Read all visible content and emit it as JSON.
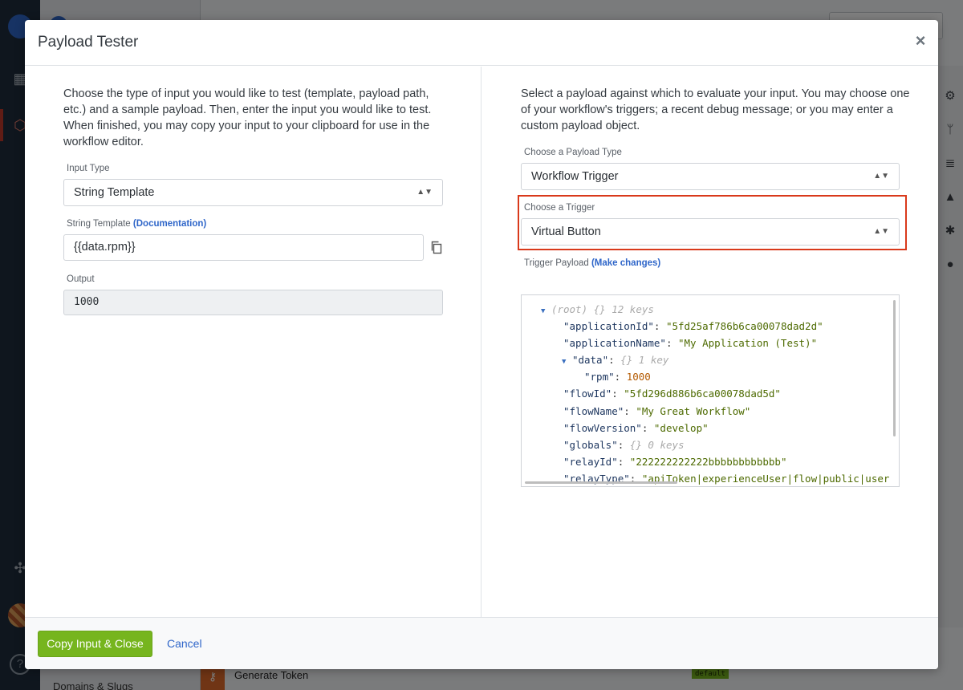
{
  "background": {
    "generate_token_label": "Generate Token",
    "default_badge": "default",
    "domains_label": "Domains & Slugs"
  },
  "modal": {
    "title": "Payload Tester",
    "close_symbol": "×",
    "left": {
      "intro": "Choose the type of input you would like to test (template, payload path, etc.) and a sample payload. Then, enter the input you would like to test. When finished, you may copy your input to your clipboard for use in the workflow editor.",
      "input_type_label": "Input Type",
      "input_type_value": "String Template",
      "string_template_label": "String Template",
      "documentation_link": "(Documentation)",
      "string_template_value": "{{data.rpm}}",
      "output_label": "Output",
      "output_value": "1000"
    },
    "right": {
      "intro": "Select a payload against which to evaluate your input. You may choose one of your workflow's triggers; a recent debug message; or you may enter a custom payload object.",
      "payload_type_label": "Choose a Payload Type",
      "payload_type_value": "Workflow Trigger",
      "trigger_label": "Choose a Trigger",
      "trigger_value": "Virtual Button",
      "trigger_payload_label": "Trigger Payload",
      "make_changes_link": "(Make changes)"
    },
    "footer": {
      "copy_button": "Copy Input & Close",
      "cancel_button": "Cancel"
    }
  },
  "payload_json": {
    "root_label": "(root)",
    "root_braces": "{}",
    "root_count": "12 keys",
    "applicationId_key": "\"applicationId\"",
    "applicationId_val": "\"5fd25af786b6ca00078dad2d\"",
    "applicationName_key": "\"applicationName\"",
    "applicationName_val": "\"My Application (Test)\"",
    "data_key": "\"data\"",
    "data_braces": "{}",
    "data_count": "1 key",
    "rpm_key": "\"rpm\"",
    "rpm_val": "1000",
    "flowId_key": "\"flowId\"",
    "flowId_val": "\"5fd296d886b6ca00078dad5d\"",
    "flowName_key": "\"flowName\"",
    "flowName_val": "\"My Great Workflow\"",
    "flowVersion_key": "\"flowVersion\"",
    "flowVersion_val": "\"develop\"",
    "globals_key": "\"globals\"",
    "globals_braces": "{}",
    "globals_count": "0 keys",
    "relayId_key": "\"relayId\"",
    "relayId_val": "\"222222222222bbbbbbbbbbbb\"",
    "relayType_key": "\"relayType\"",
    "relayType_val": "\"apiToken|experienceUser|flow|public|user"
  },
  "colors": {
    "primary_button": "#76b51e",
    "link": "#2f66c9",
    "highlight": "#d9391b",
    "nav_bg": "#1e2c3c"
  },
  "icons": [
    "close-icon",
    "select-arrows-icon",
    "copy-icon",
    "expand-triangle-icon"
  ]
}
